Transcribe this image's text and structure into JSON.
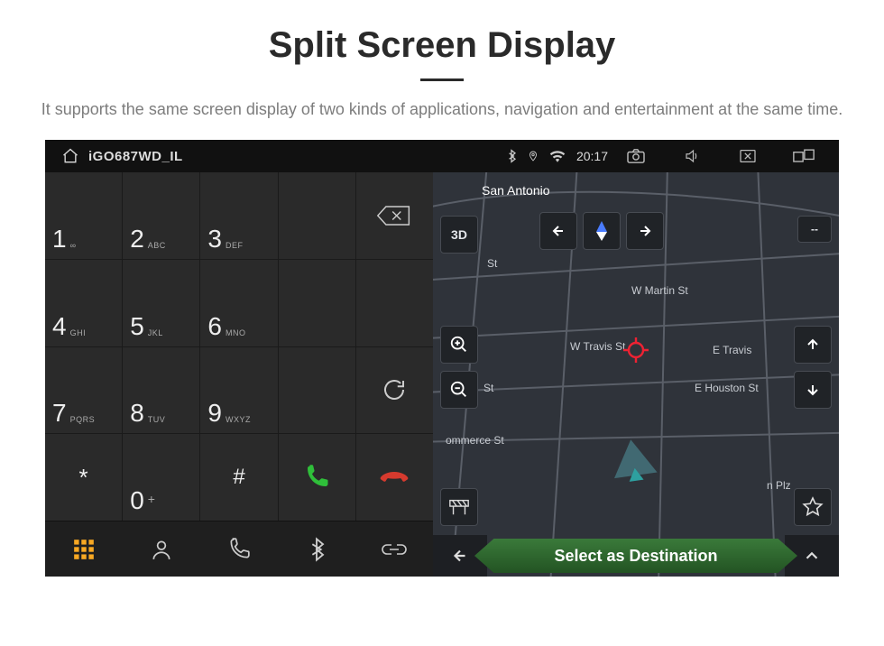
{
  "heading": "Split Screen Display",
  "description": "It supports the same screen display of two kinds of applications, navigation and entertainment at the same time.",
  "statusbar": {
    "title": "iGO687WD_IL",
    "time": "20:17"
  },
  "dialer": {
    "keys": [
      {
        "num": "1",
        "sub": "∞"
      },
      {
        "num": "2",
        "sub": "ABC"
      },
      {
        "num": "3",
        "sub": "DEF"
      },
      {
        "num": "4",
        "sub": "GHI"
      },
      {
        "num": "5",
        "sub": "JKL"
      },
      {
        "num": "6",
        "sub": "MNO"
      },
      {
        "num": "7",
        "sub": "PQRS"
      },
      {
        "num": "8",
        "sub": "TUV"
      },
      {
        "num": "9",
        "sub": "WXYZ"
      },
      {
        "num": "*",
        "sub": ""
      },
      {
        "num": "0",
        "sub": "+"
      },
      {
        "num": "#",
        "sub": ""
      }
    ]
  },
  "map": {
    "city_label": "San Antonio",
    "mode_label": "3D",
    "streets": {
      "martin": "W Martin St",
      "travis": "W Travis St",
      "etravis": "E Travis",
      "ehouston": "E Houston St",
      "commerce": "ommerce St",
      "plz": "n Plz",
      "stS": "St",
      "stN": "St"
    },
    "dash": "--",
    "dest_label": "Select as Destination"
  }
}
